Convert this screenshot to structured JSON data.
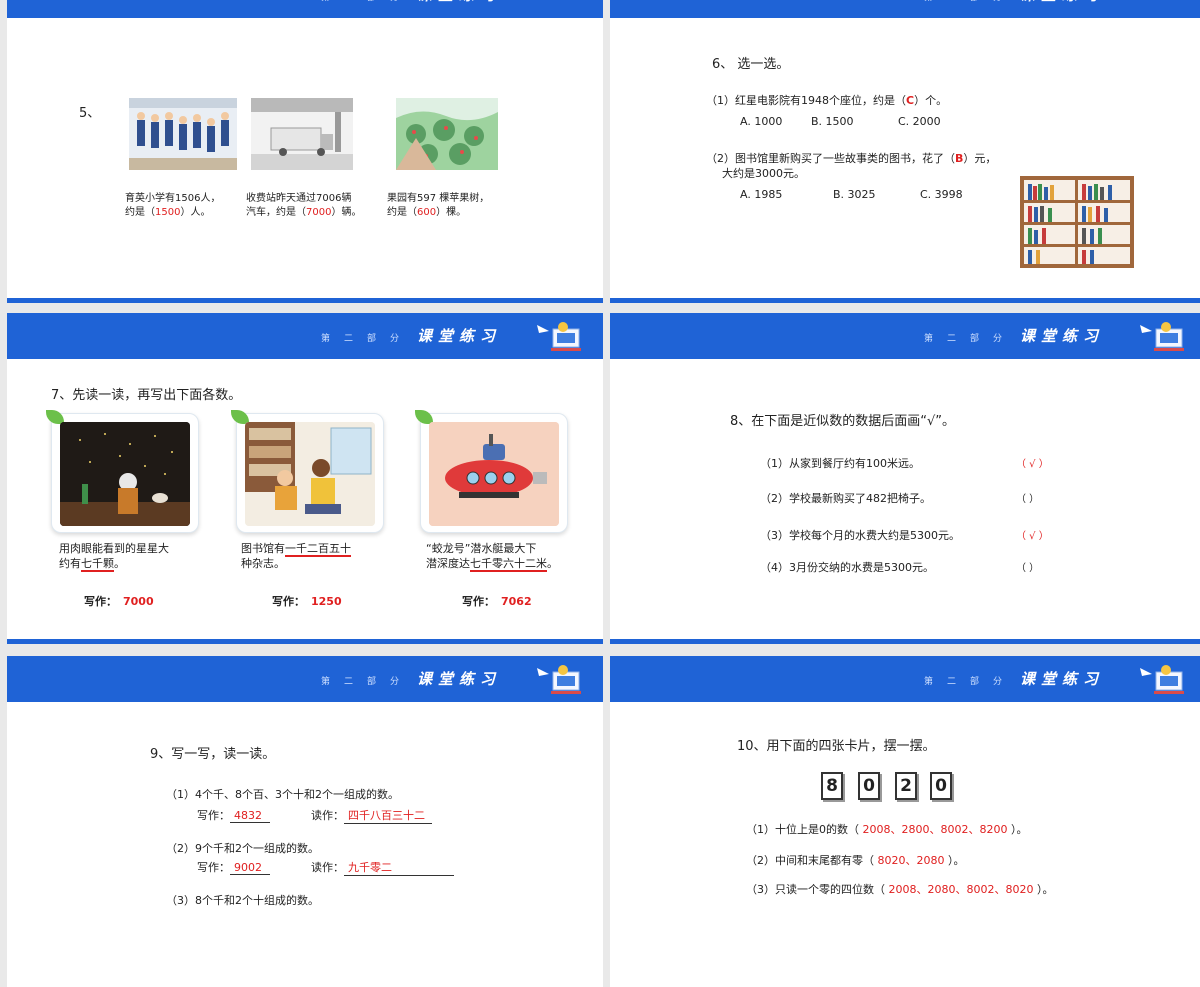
{
  "header": {
    "section": "第二部分",
    "title": "课堂练习"
  },
  "slide1": {
    "num": "5、",
    "items": [
      {
        "l1": "育英小学有1506人，",
        "l2a": "约是（",
        "ans": "1500",
        "l2b": "）人。"
      },
      {
        "l1": "收费站昨天通过7006辆",
        "l2a": "汽车，约是（",
        "ans": "7000",
        "l2b": "）辆。"
      },
      {
        "l1": "果园有597 棵苹果树，",
        "l2a": "约是（",
        "ans": "600",
        "l2b": "）棵。"
      }
    ]
  },
  "slide2": {
    "title": "6、 选一选。",
    "q1a": "（1）红星电影院有1948个座位，约是（",
    "q1ans": "C",
    "q1b": "）个。",
    "q1opts": [
      "A. 1000",
      "B. 1500",
      "C. 2000"
    ],
    "q2a": "（2）图书馆里新购买了一些故事类的图书，花了（",
    "q2ans": "B",
    "q2b": "）元，",
    "q2line2": "大约是3000元。",
    "q2opts": [
      "A. 1985",
      "B. 3025",
      "C. 3998"
    ]
  },
  "slide3": {
    "title": "7、先读一读，再写出下面各数。",
    "items": [
      {
        "t1": "用肉眼能看到的星星大",
        "t2a": "约有",
        "t2u": "七千颗",
        "t2b": "。",
        "label": "写作：",
        "ans": "7000"
      },
      {
        "t1a": "图书馆有",
        "t1u": "一千二百五十",
        "t2": "种杂志。",
        "label": "写作：",
        "ans": "1250"
      },
      {
        "t1": "“蛟龙号”潜水艇最大下",
        "t2a": "潜深度达",
        "t2u": "七千零六十二米",
        "t2b": "。",
        "label": "写作：",
        "ans": "7062"
      }
    ]
  },
  "slide4": {
    "title": "8、在下面是近似数的数据后面画“√”。",
    "items": [
      {
        "q": "（1）从家到餐厅约有100米远。",
        "mark": "（ √ ）"
      },
      {
        "q": "（2）学校最新购买了482把椅子。",
        "mark": "（    ）"
      },
      {
        "q": "（3）学校每个月的水费大约是5300元。",
        "mark": "（ √ ）"
      },
      {
        "q": "（4）3月份交纳的水费是5300元。",
        "mark": "（    ）"
      }
    ]
  },
  "slide5": {
    "title": "9、写一写，读一读。",
    "q1": "（1）4个千、8个百、3个十和2个一组成的数。",
    "q1w": "写作：",
    "q1wa": "4832",
    "q1r": "读作：",
    "q1ra": "四千八百三十二",
    "q2": "（2）9个千和2个一组成的数。",
    "q2w": "写作：",
    "q2wa": "9002",
    "q2r": "读作：",
    "q2ra": "九千零二",
    "q3": "（3）8个千和2个十组成的数。"
  },
  "slide6": {
    "title": "10、用下面的四张卡片，摆一摆。",
    "cards": [
      "8",
      "0",
      "2",
      "0"
    ],
    "q1a": "（1）十位上是0的数（ ",
    "q1ans": "2008、2800、8002、8200",
    "q1b": " ）。",
    "q2a": "（2）中间和末尾都有零（ ",
    "q2ans": "8020、2080",
    "q2b": " ）。",
    "q3a": "（3）只读一个零的四位数（ ",
    "q3ans": "2008、2080、8002、8020",
    "q3b": " ）。"
  }
}
